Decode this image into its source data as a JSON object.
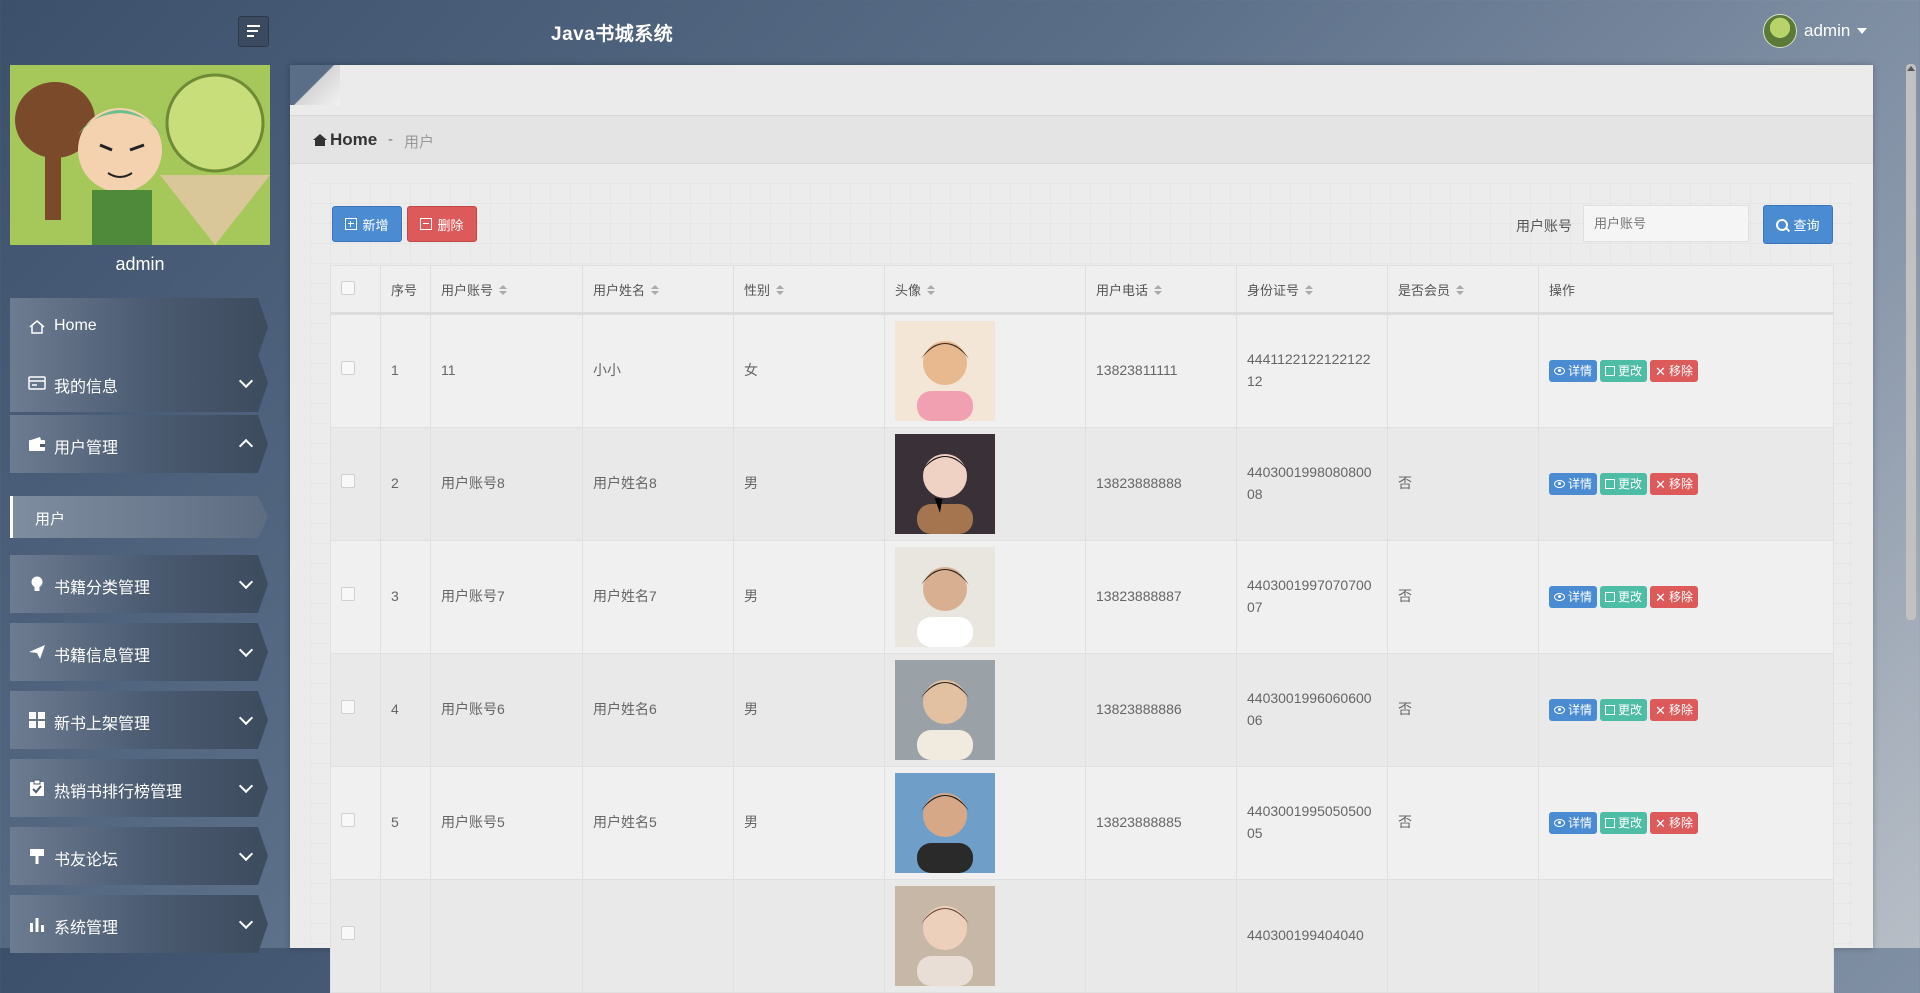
{
  "header": {
    "title": "Java书城系统",
    "username": "admin"
  },
  "sidebar": {
    "profile_name": "admin",
    "items": [
      {
        "label": "Home",
        "icon": "home-icon",
        "expandable": false
      },
      {
        "label": "我的信息",
        "icon": "card-icon",
        "expandable": true,
        "expanded": false
      },
      {
        "label": "用户管理",
        "icon": "wallet-icon",
        "expandable": true,
        "expanded": true
      },
      {
        "label": "书籍分类管理",
        "icon": "lightbulb-icon",
        "expandable": true,
        "expanded": false
      },
      {
        "label": "书籍信息管理",
        "icon": "paper-plane-icon",
        "expandable": true,
        "expanded": false
      },
      {
        "label": "新书上架管理",
        "icon": "grid-icon",
        "expandable": true,
        "expanded": false
      },
      {
        "label": "热销书排行榜管理",
        "icon": "clipboard-check-icon",
        "expandable": true,
        "expanded": false
      },
      {
        "label": "书友论坛",
        "icon": "signpost-icon",
        "expandable": true,
        "expanded": false
      },
      {
        "label": "系统管理",
        "icon": "bar-chart-icon",
        "expandable": true,
        "expanded": false
      }
    ],
    "subitem": "用户"
  },
  "breadcrumb": {
    "home": "Home",
    "separator": "-",
    "current": "用户"
  },
  "toolbar": {
    "add_label": "新增",
    "delete_label": "删除",
    "search_label": "用户账号",
    "search_placeholder": "用户账号",
    "query_label": "查询"
  },
  "table": {
    "headers": [
      "序号",
      "用户账号",
      "用户姓名",
      "性别",
      "头像",
      "用户电话",
      "身份证号",
      "是否会员",
      "操作"
    ],
    "rows": [
      {
        "index": "1",
        "account": "11",
        "name": "小小",
        "gender": "女",
        "phone": "13823811111",
        "id_number": "444112212212212212",
        "member": ""
      },
      {
        "index": "2",
        "account": "用户账号8",
        "name": "用户姓名8",
        "gender": "男",
        "phone": "13823888888",
        "id_number": "440300199808080008",
        "member": "否"
      },
      {
        "index": "3",
        "account": "用户账号7",
        "name": "用户姓名7",
        "gender": "男",
        "phone": "13823888887",
        "id_number": "440300199707070007",
        "member": "否"
      },
      {
        "index": "4",
        "account": "用户账号6",
        "name": "用户姓名6",
        "gender": "男",
        "phone": "13823888886",
        "id_number": "440300199606060006",
        "member": "否"
      },
      {
        "index": "5",
        "account": "用户账号5",
        "name": "用户姓名5",
        "gender": "男",
        "phone": "13823888885",
        "id_number": "440300199505050005",
        "member": "否"
      },
      {
        "index": "",
        "account": "",
        "name": "",
        "gender": "",
        "phone": "",
        "id_number": "440300199404040",
        "member": ""
      }
    ],
    "actions": {
      "detail": "详情",
      "edit": "更改",
      "remove": "移除"
    }
  },
  "colors": {
    "primary": "#4a8bd2",
    "success": "#4dbda6",
    "danger": "#dc5a5a"
  }
}
